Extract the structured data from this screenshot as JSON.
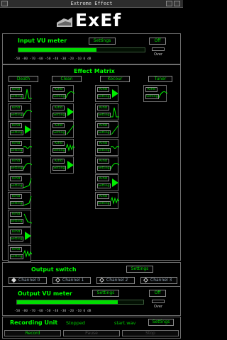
{
  "window": {
    "title": "Extreme Effect"
  },
  "logo": {
    "text": "ExEf"
  },
  "input_vu": {
    "label": "Input VU meter",
    "settings": "Settings",
    "off": "Off",
    "over": "Over",
    "level": 0.62,
    "ticks": "-50 -80 -70 -60 -50 -40 -30 -20 -10 0 dB"
  },
  "effect_matrix": {
    "title": "Effect Matrix",
    "columns": [
      "Death",
      "Clean",
      "Kocour",
      "Tuner"
    ],
    "kind_label": "Kind",
    "settings_label": "Settings"
  },
  "output_switch": {
    "label": "Output switch",
    "settings": "Settings",
    "channels": [
      "Channel 0",
      "Channel 1",
      "Channel 2",
      "Channel 3"
    ],
    "selected": "Channel 0"
  },
  "output_vu": {
    "label": "Output VU meter",
    "settings": "Settings",
    "off": "Off",
    "over": "Over",
    "level": 0.8,
    "ticks": "-50 -80 -70 -60 -50 -40 -30 -20 -10 0 dB"
  },
  "recording": {
    "label": "Recording Unit",
    "status": "Stopped",
    "filename": "start.wav",
    "settings": "Settings",
    "record": "Record",
    "pause": "Pause",
    "stop": "Stop"
  },
  "colors": {
    "accent": "#00ff00",
    "background": "#000000",
    "border": "#6e6e6e"
  }
}
